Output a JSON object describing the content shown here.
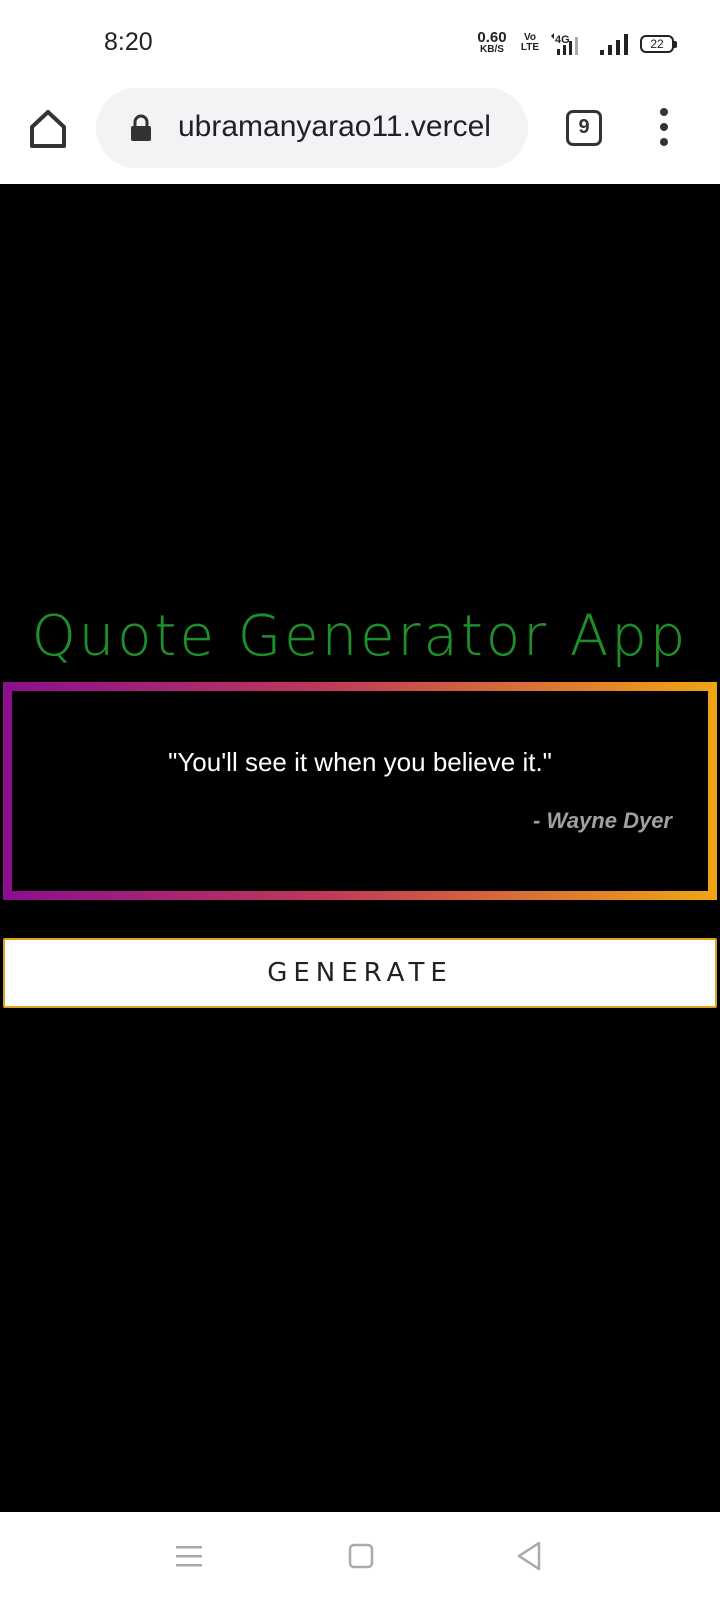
{
  "status_bar": {
    "time": "8:20",
    "net_speed_value": "0.60",
    "net_speed_unit": "KB/S",
    "volte": "Vo LTE",
    "network_type": "4G",
    "battery": "22"
  },
  "browser": {
    "url": "ubramanyarao11.vercel",
    "tab_count": "9"
  },
  "app": {
    "title": "Quote Generator App",
    "quote": "\"You'll see it when you believe it.\"",
    "author": "- Wayne Dyer",
    "generate_label": "GENERATE"
  },
  "colors": {
    "background": "#000000",
    "title": "#1f8f2a",
    "card_gradient_start": "#8b0f8e",
    "card_gradient_end": "#f0a513",
    "author": "#a0a0a0"
  }
}
